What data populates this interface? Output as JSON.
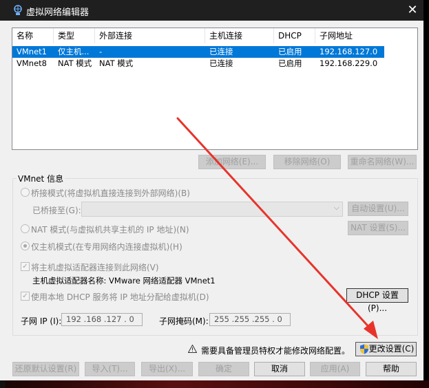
{
  "window": {
    "title": "虚拟网络编辑器",
    "close_glyph": "✕"
  },
  "list": {
    "columns": [
      "名称",
      "类型",
      "外部连接",
      "主机连接",
      "DHCP",
      "子网地址"
    ],
    "rows": [
      {
        "name": "VMnet1",
        "type": "仅主机...",
        "external": "-",
        "host": "已连接",
        "dhcp": "已启用",
        "subnet": "192.168.127.0",
        "selected": true
      },
      {
        "name": "VMnet8",
        "type": "NAT 模式",
        "external": "NAT 模式",
        "host": "已连接",
        "dhcp": "已启用",
        "subnet": "192.168.229.0",
        "selected": false
      }
    ]
  },
  "list_buttons": {
    "add": "添加网络(E)...",
    "remove": "移除网络(O)",
    "rename": "重命名网络(W)..."
  },
  "vmnet_info": {
    "group_label": "VMnet 信息",
    "bridged_label": "桥接模式(将虚拟机直接连接到外部网络)(B)",
    "bridged_to_label": "已桥接至(G):",
    "bridged_to_value": "",
    "auto_button": "自动设置(U)...",
    "nat_label": "NAT 模式(与虚拟机共享主机的 IP 地址)(N)",
    "nat_button": "NAT 设置(S)...",
    "hostonly_label": "仅主机模式(在专用网络内连接虚拟机)(H)",
    "connect_adapter_label": "将主机虚拟适配器连接到此网络(V)",
    "adapter_name_label": "主机虚拟适配器名称: VMware 网络适配器 VMnet1",
    "dhcp_label": "使用本地 DHCP 服务将 IP 地址分配给虚拟机(D)",
    "dhcp_button": "DHCP 设置(P)...",
    "subnet_ip_label": "子网 IP (I):",
    "subnet_ip_value": "192 .168 .127 . 0",
    "subnet_mask_label": "子网掩码(M):",
    "subnet_mask_value": "255 .255 .255 . 0"
  },
  "admin": {
    "warning_text": "需要具备管理员特权才能修改网络配置。",
    "change_button": "更改设置(C)"
  },
  "footer_buttons": {
    "restore": "还原默认设置(R)",
    "import": "导入(T)...",
    "export": "导出(X)...",
    "ok": "确定",
    "cancel": "取消",
    "apply": "应用(A)",
    "help": "帮助"
  },
  "colors": {
    "selection": "#0078d7",
    "annotation_arrow": "#e8332b"
  },
  "icons": [
    "network-icon",
    "close-icon",
    "warning-icon",
    "shield-icon",
    "chevron-down-icon",
    "red-arrow-annotation"
  ]
}
